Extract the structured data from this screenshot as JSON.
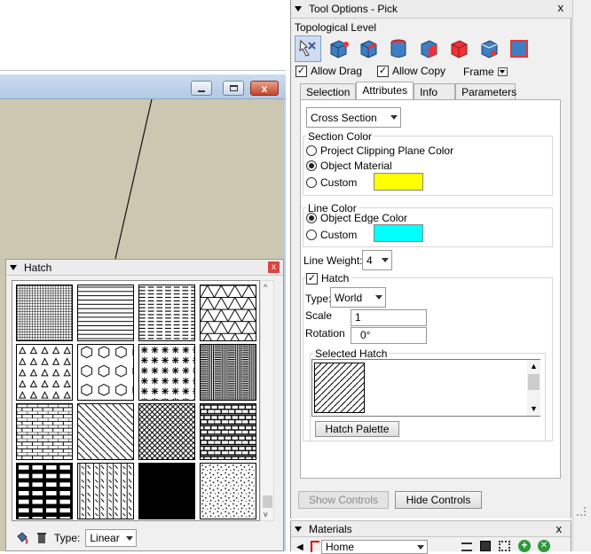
{
  "viewport_window": {
    "min_icon": "minimize-icon",
    "max_icon": "maximize-icon",
    "close_label": "x"
  },
  "hatch_panel": {
    "title": "Hatch",
    "close_label": "x",
    "type_label": "Type:",
    "type_value": "Linear",
    "scroll_up": "^",
    "scroll_down": "v",
    "icons": [
      "paint-bucket-icon",
      "trash-icon"
    ]
  },
  "tool_options": {
    "title": "Tool Options - Pick",
    "close_label": "x",
    "topological_level_label": "Topological Level",
    "topo_icons": [
      "pick-tool-icon",
      "vertex-cube-icon",
      "edge-cube-icon",
      "cylinder-icon",
      "face-cube-icon",
      "solid-cube-icon",
      "group-cube-icon",
      "component-cube-icon"
    ],
    "allow_drag_label": "Allow Drag",
    "allow_drag_checked": "✓",
    "allow_copy_label": "Allow Copy",
    "allow_copy_checked": "✓",
    "frame_label": "Frame",
    "tabs": [
      "Selection",
      "Attributes",
      "Info",
      "Parameters"
    ],
    "active_tab": "Attributes",
    "section_select": "Cross Section",
    "section_color": {
      "label": "Section Color",
      "options": [
        "Project Clipping Plane Color",
        "Object Material",
        "Custom"
      ],
      "selected": "Object Material",
      "custom_color": "#ffff00"
    },
    "line_color": {
      "label": "Line Color",
      "options": [
        "Object Edge Color",
        "Custom"
      ],
      "selected": "Object Edge Color",
      "custom_color": "#00ffff"
    },
    "line_weight_label": "Line Weight:",
    "line_weight_value": "4",
    "hatch_label": "Hatch",
    "hatch_checked": "✓",
    "type_label": "Type:",
    "type_value": "World",
    "scale_label": "Scale",
    "scale_value": "1",
    "rotation_label": "Rotation",
    "rotation_value": "0°",
    "selected_hatch_label": "Selected Hatch",
    "hatch_palette_button": "Hatch Palette",
    "show_controls_button": "Show Controls",
    "hide_controls_button": "Hide Controls"
  },
  "materials_panel": {
    "title": "Materials",
    "close_label": "x",
    "home_value": "Home",
    "back_icon": "back-arrow-icon",
    "icons": [
      "list-view-icon",
      "color-swatch-icon",
      "grid-view-icon",
      "add-material-icon",
      "refresh-material-icon"
    ]
  }
}
